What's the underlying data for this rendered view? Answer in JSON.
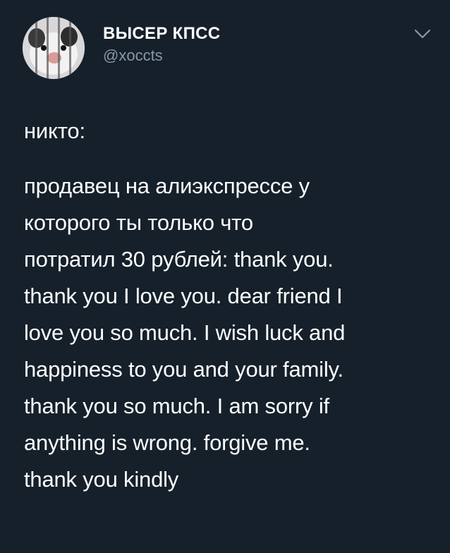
{
  "user": {
    "display_name": "ВЫСЕР КПСС",
    "handle": "@xoccts",
    "avatar_icon": "hamster-avatar-icon",
    "menu_icon": "chevron-down-icon"
  },
  "tweet": {
    "intro": "никто:",
    "lines": [
      "продавец на алиэкспрессе у",
      "которого ты только что",
      "потратил 30 рублей: thank you.",
      "thank you I love you. dear friend I",
      "love you so much. I wish luck and",
      "happiness to you and your family.",
      "thank you so much. I am sorry if",
      "anything is wrong. forgive me.",
      "thank you kindly"
    ]
  },
  "colors": {
    "background": "#15202b",
    "text": "#ffffff",
    "secondary_text": "#8899a6"
  }
}
